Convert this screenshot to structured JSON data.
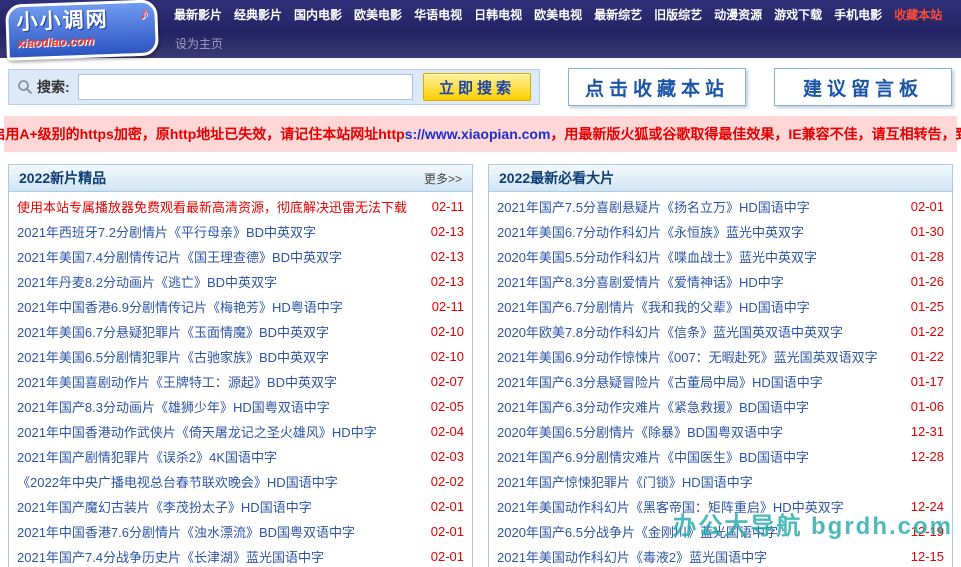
{
  "logo": {
    "title": "小小调网",
    "domain": "xiaodiao.com"
  },
  "nav": {
    "set_home": "设为主页",
    "items": [
      {
        "label": "最新影片"
      },
      {
        "label": "经典影片"
      },
      {
        "label": "国内电影"
      },
      {
        "label": "欧美电影"
      },
      {
        "label": "华语电视"
      },
      {
        "label": "日韩电视"
      },
      {
        "label": "欧美电视"
      },
      {
        "label": "最新综艺"
      },
      {
        "label": "旧版综艺"
      },
      {
        "label": "动漫资源"
      },
      {
        "label": "游戏下载"
      },
      {
        "label": "手机电影"
      },
      {
        "label": "收藏本站",
        "highlight": true
      }
    ]
  },
  "search": {
    "label": "搜索:",
    "value": "",
    "button": "立即搜索"
  },
  "actions": {
    "favorite": "点击收藏本站",
    "suggest": "建议留言板"
  },
  "notice": {
    "prefix": "网站启用A+级别的https加密，原http地址已失效，请记住本站网址http",
    "url": "s://www.xiaopian.com",
    "suffix": " ，用最新版火狐或谷歌取得最佳效果，IE兼容不佳，请互相转告，致谢！"
  },
  "left_panel": {
    "title": "2022新片精品",
    "more": "更多>>",
    "items": [
      {
        "text": "使用本站专属播放器免费观看最新高清资源，彻底解决迅雷无法下载",
        "date": "02-11",
        "highlight": true
      },
      {
        "text": "2021年西班牙7.2分剧情片《平行母亲》BD中英双字",
        "date": "02-13"
      },
      {
        "text": "2021年美国7.4分剧情传记片《国王理查德》BD中英双字",
        "date": "02-13"
      },
      {
        "text": "2021年丹麦8.2分动画片《逃亡》BD中英双字",
        "date": "02-13"
      },
      {
        "text": "2021年中国香港6.9分剧情传记片《梅艳芳》HD粤语中字",
        "date": "02-11"
      },
      {
        "text": "2021年美国6.7分悬疑犯罪片《玉面情魔》BD中英双字",
        "date": "02-10"
      },
      {
        "text": "2021年美国6.5分剧情犯罪片《古驰家族》BD中英双字",
        "date": "02-10"
      },
      {
        "text": "2021年美国喜剧动作片《王牌特工：源起》BD中英双字",
        "date": "02-07"
      },
      {
        "text": "2021年国产8.3分动画片《雄狮少年》HD国粤双语中字",
        "date": "02-05"
      },
      {
        "text": "2021年中国香港动作武侠片《倚天屠龙记之圣火雄风》HD中字",
        "date": "02-04"
      },
      {
        "text": "2021年国产剧情犯罪片《误杀2》4K国语中字",
        "date": "02-03"
      },
      {
        "text": "《2022年中央广播电视总台春节联欢晚会》HD国语中字",
        "date": "02-02"
      },
      {
        "text": "2021年国产魔幻古装片《李茂扮太子》HD国语中字",
        "date": "02-01"
      },
      {
        "text": "2021年中国香港7.6分剧情片《浊水漂流》BD国粤双语中字",
        "date": "02-01"
      },
      {
        "text": "2021年国产7.4分战争历史片《长津湖》蓝光国语中字",
        "date": "02-01"
      }
    ]
  },
  "right_panel": {
    "title": "2022最新必看大片",
    "items": [
      {
        "text": "2021年国产7.5分喜剧悬疑片《扬名立万》HD国语中字",
        "date": "02-01"
      },
      {
        "text": "2021年美国6.7分动作科幻片《永恒族》蓝光中英双字",
        "date": "01-30"
      },
      {
        "text": "2020年美国5.5分动作科幻片《喋血战士》蓝光中英双字",
        "date": "01-28"
      },
      {
        "text": "2021年国产8.3分喜剧爱情片《爱情神话》HD中字",
        "date": "01-26"
      },
      {
        "text": "2021年国产6.7分剧情片《我和我的父辈》HD国语中字",
        "date": "01-25"
      },
      {
        "text": "2020年欧美7.8分动作科幻片《信条》蓝光国英双语中英双字",
        "date": "01-22"
      },
      {
        "text": "2021年美国6.9分动作惊悚片《007：无暇赴死》蓝光国英双语双字",
        "date": "01-22"
      },
      {
        "text": "2021年国产6.3分悬疑冒险片《古董局中局》HD国语中字",
        "date": "01-17"
      },
      {
        "text": "2021年国产6.3分动作灾难片《紧急救援》BD国语中字",
        "date": "01-06"
      },
      {
        "text": "2020年美国6.5分剧情片《除暴》BD国粤双语中字",
        "date": "12-31"
      },
      {
        "text": "2021年国产6.9分剧情灾难片《中国医生》BD国语中字",
        "date": "12-28"
      },
      {
        "text": "2021年国产惊悚犯罪片《门锁》HD国语中字",
        "date": ""
      },
      {
        "text": "2021年美国动作科幻片《黑客帝国：矩阵重启》HD中英双字",
        "date": "12-24"
      },
      {
        "text": "2020年国产6.5分战争片《金刚川》蓝光国语中字",
        "date": "12-19"
      },
      {
        "text": "2021年美国动作科幻片《毒液2》蓝光国语中字",
        "date": "12-15"
      }
    ]
  },
  "watermark": "办公大导航 bgrdh.com"
}
